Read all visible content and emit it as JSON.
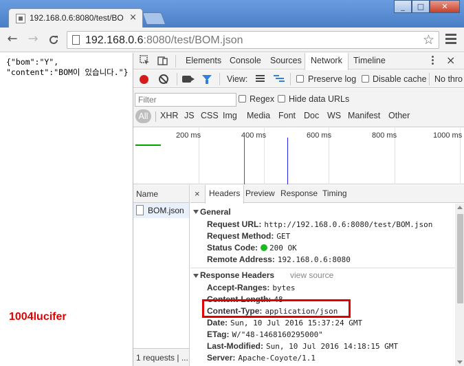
{
  "browser": {
    "tab_title": "192.168.0.6:8080/test/BO",
    "tab_close": "×",
    "url_host": "192.168.0.6",
    "url_rest": ":8080/test/BOM.json",
    "window_minimize": "_",
    "window_maximize": "□",
    "window_close": "✕",
    "nav_back": "←",
    "nav_forward": "→",
    "nav_reload": "C",
    "bookmark_star": "☆"
  },
  "page": {
    "json_text": "{\"bom\":\"Y\",\n\"content\":\"BOM이 있습니다.\"}",
    "watermark": "1004lucifer"
  },
  "devtools": {
    "tabs": [
      "Elements",
      "Console",
      "Sources",
      "Network",
      "Timeline"
    ],
    "active_tab": "Network",
    "close": "×",
    "network_toolbar": {
      "view_label": "View:",
      "preserve_log": "Preserve log",
      "disable_cache": "Disable cache",
      "throttle": "No thro"
    },
    "filter": {
      "placeholder": "Filter",
      "regex": "Regex",
      "hide_data_urls": "Hide data URLs",
      "types": [
        "All",
        "XHR",
        "JS",
        "CSS",
        "Img",
        "Media",
        "Font",
        "Doc",
        "WS",
        "Manifest",
        "Other"
      ]
    },
    "overview": {
      "ticks": [
        "200 ms",
        "400 ms",
        "600 ms",
        "800 ms",
        "1000 ms"
      ]
    },
    "request_list": {
      "header": "Name",
      "rows": [
        "BOM.json"
      ],
      "footer": "1 requests | ..."
    },
    "detail": {
      "close": "×",
      "tabs": [
        "Headers",
        "Preview",
        "Response",
        "Timing"
      ],
      "active_tab": "Headers",
      "general": {
        "title": "General",
        "items": [
          {
            "key": "Request URL:",
            "value": "http://192.168.0.6:8080/test/BOM.json"
          },
          {
            "key": "Request Method:",
            "value": "GET"
          },
          {
            "key": "Status Code:",
            "value": "200 OK"
          },
          {
            "key": "Remote Address:",
            "value": "192.168.0.6:8080"
          }
        ]
      },
      "response_headers": {
        "title": "Response Headers",
        "view_source": "view source",
        "items": [
          {
            "key": "Accept-Ranges:",
            "value": "bytes"
          },
          {
            "key": "Content-Length:",
            "value": "48"
          },
          {
            "key": "Content-Type:",
            "value": "application/json"
          },
          {
            "key": "Date:",
            "value": "Sun, 10 Jul 2016 15:37:24 GMT"
          },
          {
            "key": "ETag:",
            "value": "W/\"48-1468160295000\""
          },
          {
            "key": "Last-Modified:",
            "value": "Sun, 10 Jul 2016 14:18:15 GMT"
          },
          {
            "key": "Server:",
            "value": "Apache-Coyote/1.1"
          }
        ]
      }
    }
  },
  "colors": {
    "highlight_box": "#e00000",
    "record_button": "#d51c1c",
    "status_ok": "#1db820",
    "filter_active": "#2f80e0"
  }
}
